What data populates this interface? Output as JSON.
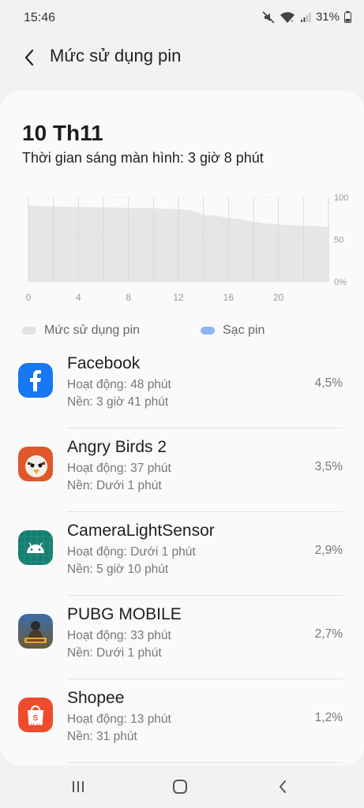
{
  "status_bar": {
    "time": "15:46",
    "battery_percent": "31%",
    "icons": [
      "mute-icon",
      "wifi-icon",
      "signal-icon",
      "battery-icon"
    ]
  },
  "header": {
    "title": "Mức sử dụng pin",
    "back_icon": "back-arrow-icon"
  },
  "summary": {
    "date": "10 Th11",
    "screen_on": "Thời gian sáng màn hình: 3 giờ 8 phút"
  },
  "chart_data": {
    "type": "area",
    "x_ticks": [
      "0",
      "4",
      "8",
      "12",
      "16",
      "20"
    ],
    "y_ticks": [
      "100",
      "50",
      "0%"
    ],
    "xlim": [
      0,
      24
    ],
    "ylim": [
      0,
      100
    ],
    "series": [
      {
        "name": "Mức sử dụng pin",
        "points": [
          [
            0,
            90
          ],
          [
            2,
            89
          ],
          [
            4,
            88.5
          ],
          [
            6,
            88
          ],
          [
            8,
            87.5
          ],
          [
            10,
            87
          ],
          [
            12,
            86
          ],
          [
            13.2,
            84
          ],
          [
            14,
            79
          ],
          [
            15,
            78
          ],
          [
            16,
            76
          ],
          [
            17,
            74
          ],
          [
            18,
            71
          ],
          [
            19,
            69
          ],
          [
            20,
            68
          ],
          [
            21,
            67
          ],
          [
            22.5,
            66
          ],
          [
            24,
            65
          ]
        ]
      }
    ],
    "grid": true,
    "colors": {
      "fill": "#e6e6e6",
      "grid": "#d4d4d4",
      "tick": "#999999"
    }
  },
  "legend": {
    "usage_label": "Mức sử dụng pin",
    "usage_color": "#e1e1e1",
    "charging_label": "Sạc pin",
    "charging_color": "#8fb3f2"
  },
  "apps": [
    {
      "name": "Facebook",
      "active": "Hoạt động: 48 phút",
      "background": "Nền: 3 giờ 41 phút",
      "percent": "4,5%",
      "icon": "facebook-icon"
    },
    {
      "name": "Angry Birds 2",
      "active": "Hoạt động: 37 phút",
      "background": "Nền: Dưới 1 phút",
      "percent": "3,5%",
      "icon": "angry-birds-icon"
    },
    {
      "name": "CameraLightSensor",
      "active": "Hoạt động: Dưới 1 phút",
      "background": "Nền: 5 giờ 10 phút",
      "percent": "2,9%",
      "icon": "android-icon"
    },
    {
      "name": "PUBG MOBILE",
      "active": "Hoạt động: 33 phút",
      "background": "Nền: Dưới 1 phút",
      "percent": "2,7%",
      "icon": "pubg-icon"
    },
    {
      "name": "Shopee",
      "active": "Hoạt động: 13 phút",
      "background": "Nền: 31 phút",
      "percent": "1,2%",
      "icon": "shopee-icon",
      "icon_text": "11.11"
    }
  ],
  "navbar": {
    "icons": [
      "recent-apps-icon",
      "home-icon",
      "back-icon"
    ]
  }
}
